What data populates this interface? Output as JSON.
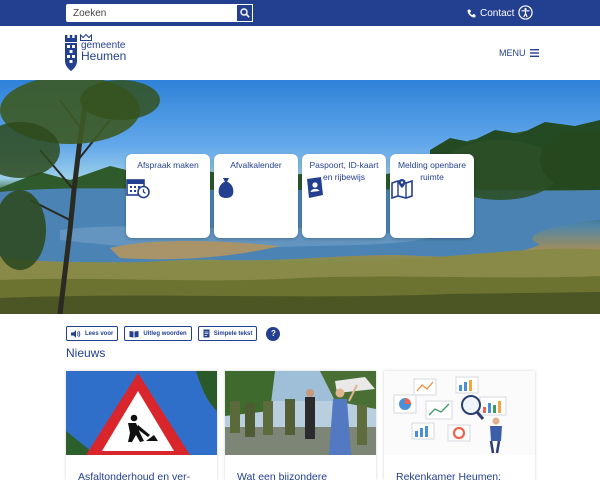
{
  "topbar": {
    "search_placeholder": "Zoeken",
    "contact_label": "Contact",
    "icons": {
      "search": "search-icon",
      "contact": "phone-icon",
      "accessibility": "accessibility-icon"
    }
  },
  "header": {
    "logo_line1": "gemeente",
    "logo_line2": "Heumen",
    "menu_label": "MENU"
  },
  "hero": {
    "tiles": [
      {
        "label": "Afspraak maken",
        "icon": "calendar-icon"
      },
      {
        "label": "Afvalkalender",
        "icon": "garbage-bag-icon"
      },
      {
        "label": "Paspoort, ID-kaart en rijbewijs",
        "icon": "passport-icon"
      },
      {
        "label": "Melding openbare ruimte",
        "icon": "map-icon"
      }
    ]
  },
  "tools": {
    "read_aloud": "Lees voor",
    "explain_words": "Uitleg woorden",
    "simple_text": "Simpele tekst",
    "help": "?"
  },
  "news": {
    "title": "Nieuws",
    "items": [
      {
        "title": "Asfaltonderhoud en ver-"
      },
      {
        "title": "Wat een bijzondere"
      },
      {
        "title": "Rekenkamer Heumen:"
      }
    ]
  },
  "colors": {
    "brand": "#233f8f",
    "white": "#ffffff"
  }
}
